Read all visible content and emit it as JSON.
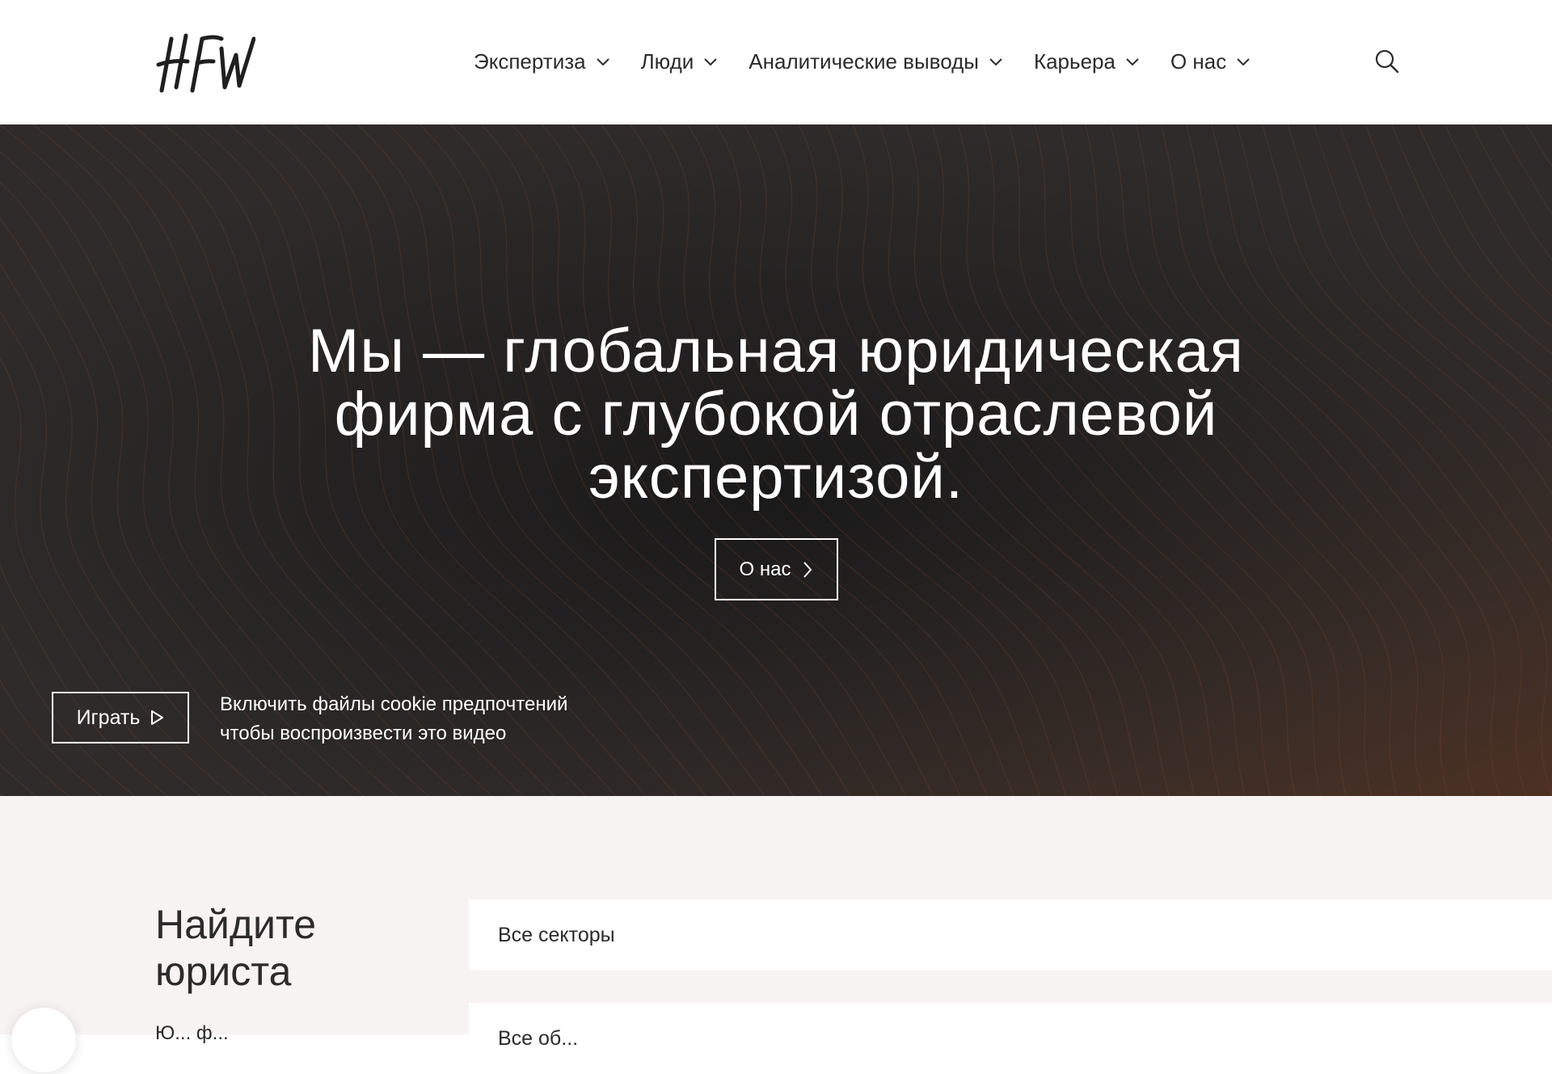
{
  "header": {
    "logo_text": "HFW",
    "nav": [
      {
        "label": "Экспертиза",
        "icon": "chevron-down-icon"
      },
      {
        "label": "Люди",
        "icon": "chevron-down-icon"
      },
      {
        "label": "Аналитические выводы",
        "icon": "chevron-down-icon"
      },
      {
        "label": "Карьера",
        "icon": "chevron-down-icon"
      },
      {
        "label": "О нас",
        "icon": "chevron-down-icon"
      }
    ],
    "search_icon": "search-icon"
  },
  "hero": {
    "title_lines": [
      "Мы — глобальная юридическая",
      "фирма с глубокой отраслевой",
      "экспертизой."
    ],
    "about_button": "О нас",
    "about_icon": "chevron-right-icon",
    "play_button": "Играть",
    "play_icon": "play-icon",
    "cookie_lines": [
      "Включить файлы cookie предпочтений",
      "чтобы воспроизвести это видео"
    ],
    "background_color": "#2a2828",
    "accent_color": "#8a4a2a"
  },
  "finder": {
    "title_lines": [
      "Найдите",
      "юриста"
    ],
    "sector_field": "Все секторы",
    "second_field": "Все об...",
    "description": "Ю... ф..."
  }
}
